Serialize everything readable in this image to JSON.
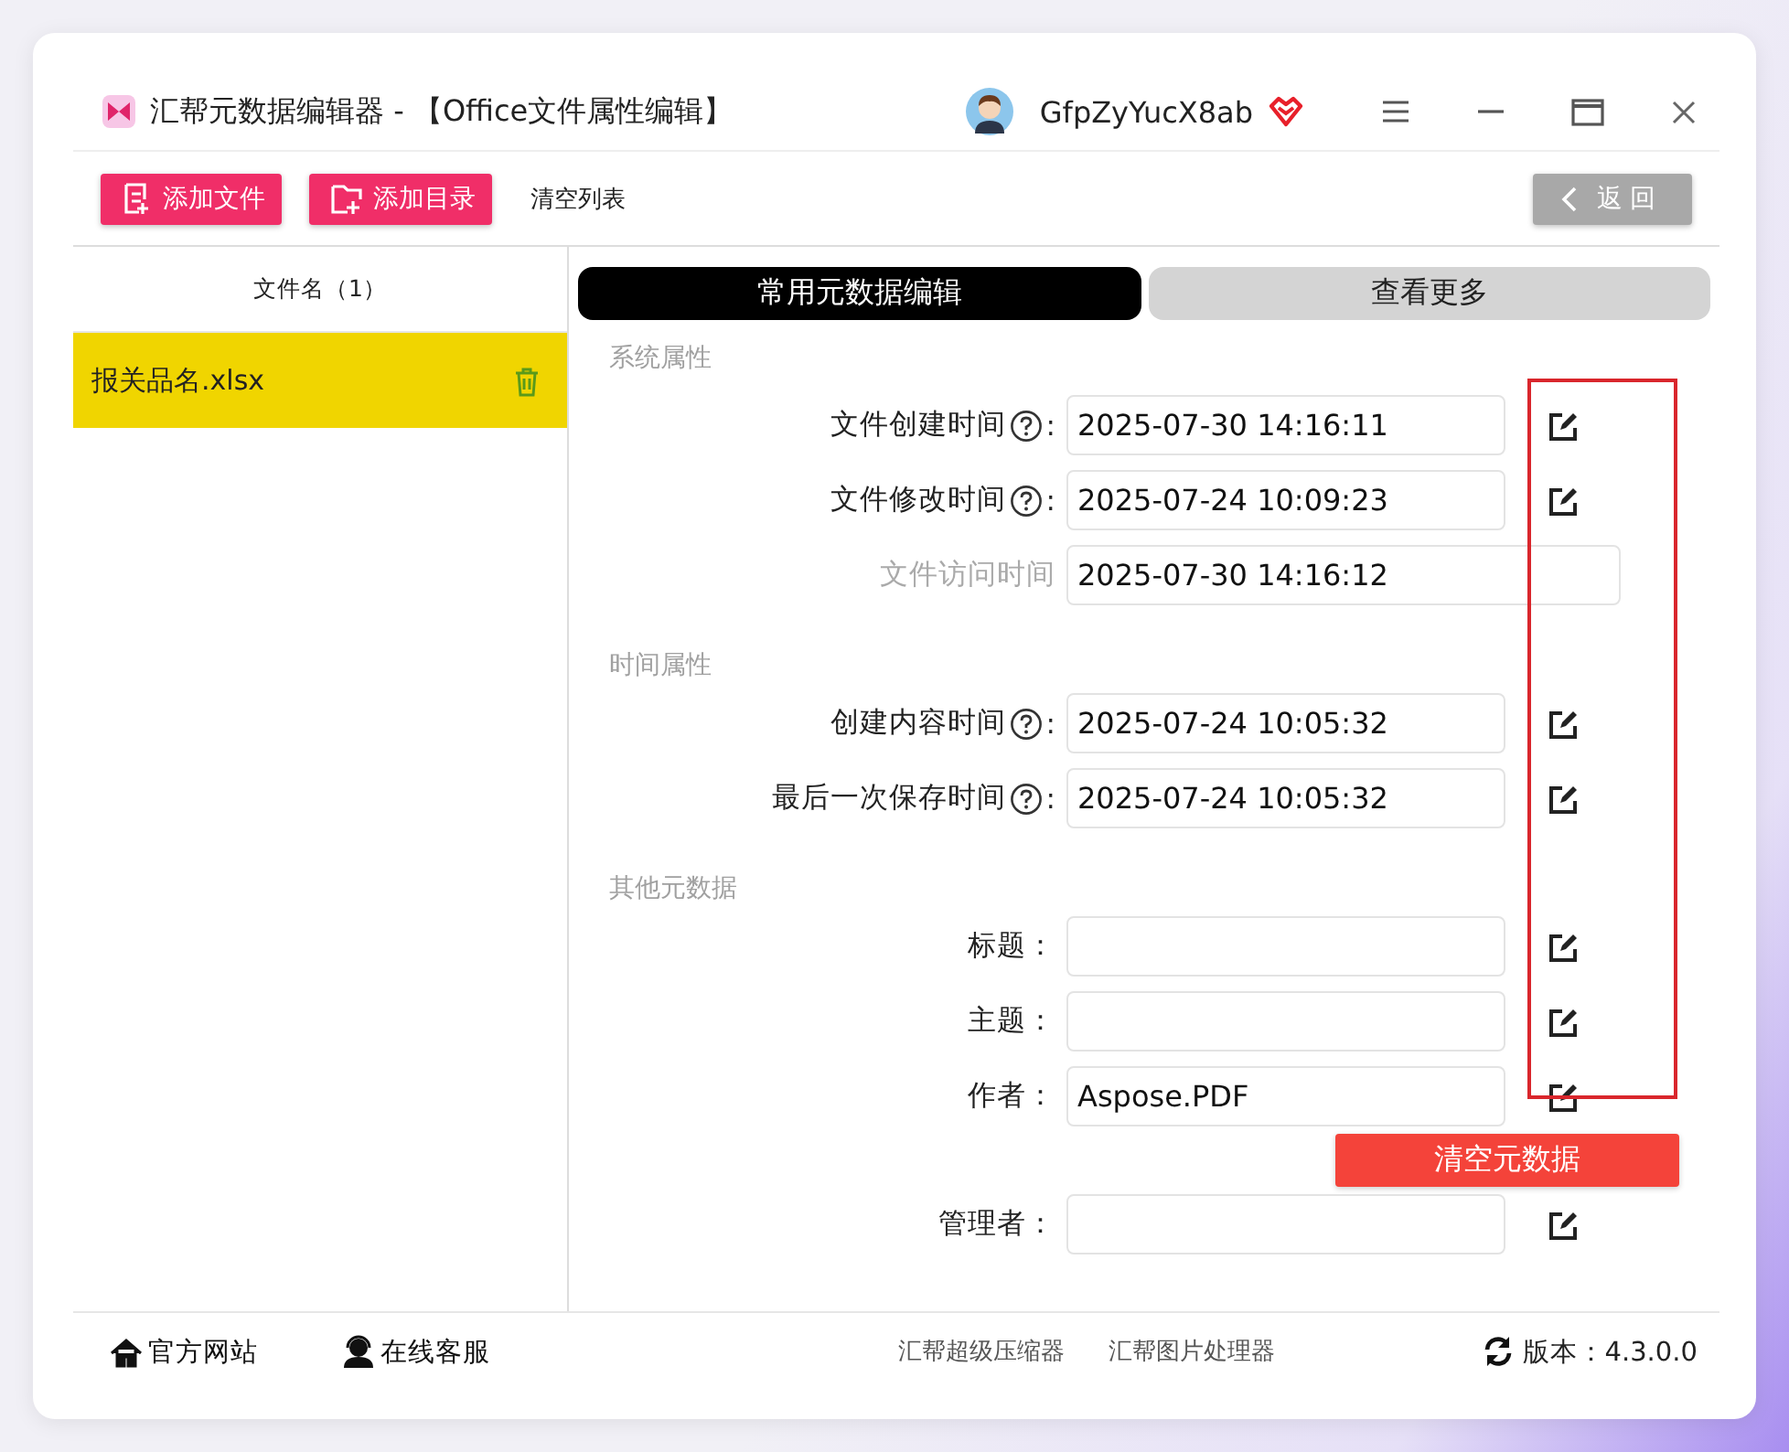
{
  "window": {
    "title": "汇帮元数据编辑器 - 【Office文件属性编辑】",
    "username": "GfpZyYucX8ab"
  },
  "toolbar": {
    "buttons": [
      {
        "label": "添加文件",
        "kind": "file"
      },
      {
        "label": "添加目录",
        "kind": "folder"
      },
      {
        "label": "清空列表",
        "kind": "plain"
      }
    ],
    "back": "返回"
  },
  "file_list": {
    "header": "文件名（1）",
    "items": [
      {
        "name": "报关品名.xlsx",
        "selected": true
      }
    ]
  },
  "tabs": [
    {
      "label": "常用元数据编辑",
      "selected": true
    },
    {
      "label": "查看更多",
      "selected": false
    }
  ],
  "sections": [
    {
      "title": "系统属性",
      "rows": [
        {
          "label": "文件创建时间",
          "help": true,
          "suffix": ":",
          "value": "2025-07-30 14:16:11",
          "disabled": false
        },
        {
          "label": "文件修改时间",
          "help": true,
          "suffix": ":",
          "value": "2025-07-24 10:09:23",
          "disabled": false
        },
        {
          "label": "文件访问时间",
          "help": false,
          "value": "2025-07-30 14:16:12",
          "disabled": true
        }
      ]
    },
    {
      "title": "时间属性",
      "rows": [
        {
          "label": "创建内容时间",
          "help": true,
          "suffix": ":",
          "value": "2025-07-24 10:05:32",
          "disabled": false
        },
        {
          "label": "最后一次保存时间",
          "help": true,
          "suffix": ":",
          "value": "2025-07-24 10:05:32",
          "disabled": false
        }
      ]
    },
    {
      "title": "其他元数据",
      "rows": [
        {
          "label": "标题：",
          "help": false,
          "disabled": false
        },
        {
          "label": "主题：",
          "help": false,
          "disabled": false
        },
        {
          "label": "作者：",
          "help": false,
          "value": "Aspose.PDF",
          "disabled": false
        },
        {
          "label": "管理者：",
          "help": false,
          "disabled": false
        }
      ]
    }
  ],
  "clear_button": "清空元数据",
  "footer": {
    "links": [
      {
        "label": "官方网站",
        "kind": "home"
      },
      {
        "label": "在线客服",
        "kind": "support"
      }
    ],
    "apps": [
      "汇帮超级压缩器",
      "汇帮图片处理器"
    ],
    "version": "版本：4.3.0.0"
  }
}
